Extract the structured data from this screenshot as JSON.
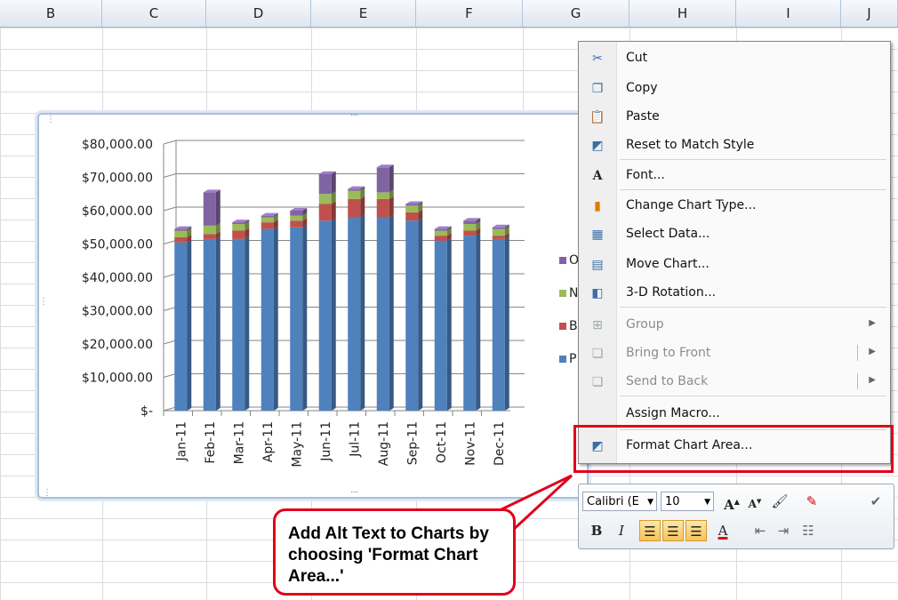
{
  "spreadsheet": {
    "columns": [
      "B",
      "C",
      "D",
      "E",
      "F",
      "G",
      "H",
      "I",
      "J"
    ]
  },
  "chart_data": {
    "type": "bar",
    "stacked": true,
    "three_d": true,
    "categories": [
      "Jan-11",
      "Feb-11",
      "Mar-11",
      "Apr-11",
      "May-11",
      "Jun-11",
      "Jul-11",
      "Aug-11",
      "Sep-11",
      "Oct-11",
      "Nov-11",
      "Dec-11"
    ],
    "ytick_labels": [
      "$80,000.00",
      "$70,000.00",
      "$60,000.00",
      "$50,000.00",
      "$40,000.00",
      "$30,000.00",
      "$20,000.00",
      "$10,000.00",
      "$-"
    ],
    "ylim": [
      0,
      80000
    ],
    "grid": true,
    "legend_position": "right",
    "series": [
      {
        "label": "P",
        "color": "#4f81bd",
        "values": [
          50500,
          51500,
          51500,
          54500,
          55000,
          57000,
          58000,
          58000,
          57000,
          51000,
          52500,
          51500
        ]
      },
      {
        "label": "B",
        "color": "#c0504d",
        "values": [
          1500,
          1500,
          2500,
          2000,
          2000,
          5000,
          5500,
          5500,
          2500,
          1500,
          1500,
          1000
        ]
      },
      {
        "label": "N",
        "color": "#9bbb59",
        "values": [
          2000,
          2500,
          2000,
          1500,
          1500,
          3000,
          2500,
          2000,
          2000,
          1500,
          2000,
          2000
        ]
      },
      {
        "label": "O",
        "color": "#8064a2",
        "values": [
          500,
          10000,
          500,
          500,
          1500,
          6000,
          500,
          7500,
          500,
          500,
          1000,
          500
        ]
      }
    ]
  },
  "context_menu": {
    "items": [
      {
        "label": "Cut",
        "icon": "scissors-icon",
        "glyph": "✂",
        "enabled": true
      },
      {
        "label": "Copy",
        "icon": "copy-icon",
        "glyph": "❐",
        "enabled": true
      },
      {
        "label": "Paste",
        "icon": "paste-icon",
        "glyph": "📋",
        "enabled": true
      },
      {
        "label": "Reset to Match Style",
        "icon": "reset-style-icon",
        "glyph": "◩",
        "enabled": true
      },
      {
        "label": "Font...",
        "icon": "font-icon",
        "glyph": "A",
        "enabled": true
      },
      {
        "label": "Change Chart Type...",
        "icon": "chart-type-icon",
        "glyph": "▮",
        "enabled": true
      },
      {
        "label": "Select Data...",
        "icon": "select-data-icon",
        "glyph": "▦",
        "enabled": true
      },
      {
        "label": "Move Chart...",
        "icon": "move-chart-icon",
        "glyph": "▤",
        "enabled": true
      },
      {
        "label": "3-D Rotation...",
        "icon": "rotation-icon",
        "glyph": "◧",
        "enabled": true
      },
      {
        "label": "Group",
        "icon": "group-icon",
        "glyph": "⊞",
        "enabled": false
      },
      {
        "label": "Bring to Front",
        "icon": "bring-front-icon",
        "glyph": "❏",
        "enabled": false
      },
      {
        "label": "Send to Back",
        "icon": "send-back-icon",
        "glyph": "❏",
        "enabled": false
      },
      {
        "label": "Assign Macro...",
        "icon": "",
        "glyph": "",
        "enabled": true
      },
      {
        "label": "Format Chart Area...",
        "icon": "format-chart-area-icon",
        "glyph": "◩",
        "enabled": true
      }
    ]
  },
  "mini_toolbar": {
    "font_name": "Calibri (E",
    "font_size": "10",
    "bold": "B",
    "italic": "I"
  },
  "callout": {
    "text": "Add Alt Text to Charts by choosing 'Format Chart Area...'"
  },
  "colors": {
    "highlight": "#e2001a"
  }
}
